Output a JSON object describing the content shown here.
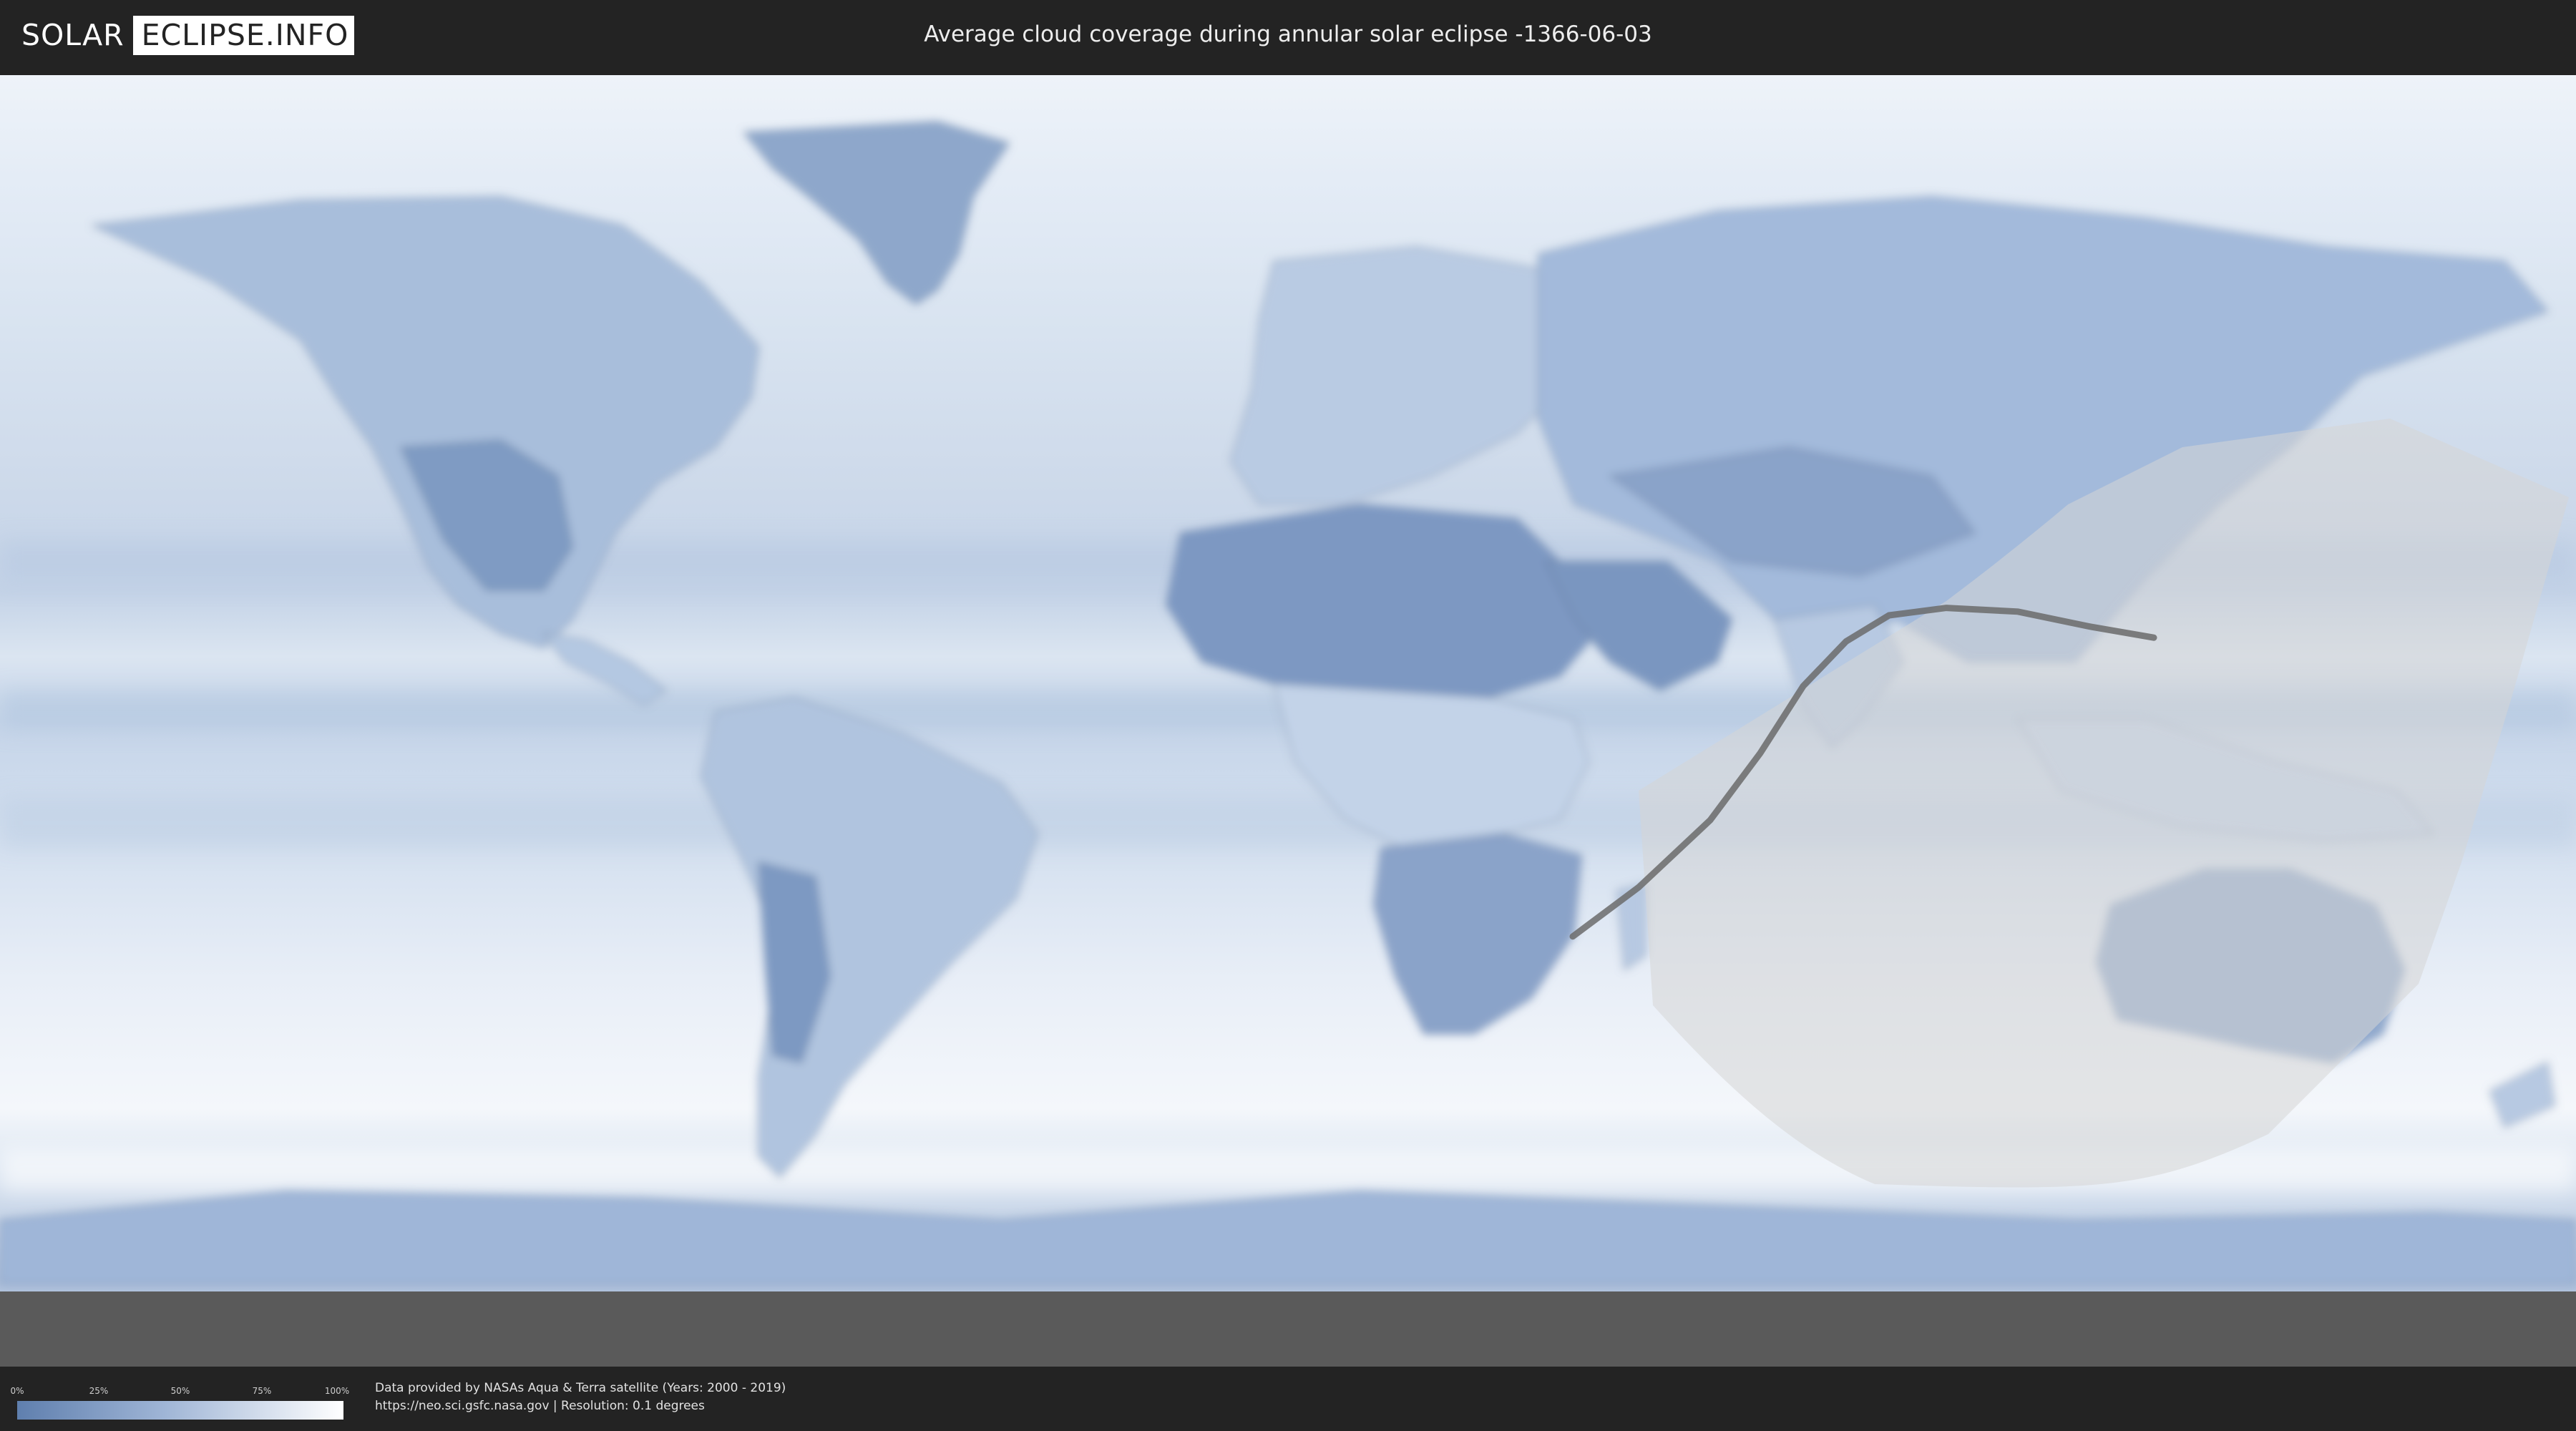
{
  "header": {
    "logo": {
      "part1": "SOLAR",
      "part2": "ECLIPSE.INFO"
    },
    "title": "Average cloud coverage during annular solar eclipse -1366-06-03"
  },
  "map": {
    "layer": "cloud-coverage",
    "colors": {
      "clear": "#5f7fae",
      "cloudy": "#ffffff",
      "eclipse_zone": "#d6d6d6",
      "central_line": "#6b6b6b",
      "page_bg": "#232323"
    },
    "central_line_path": [
      [
        39.8,
        -31.6
      ],
      [
        49,
        -25
      ],
      [
        59,
        -16
      ],
      [
        66,
        -7
      ],
      [
        72,
        2
      ],
      [
        78,
        8
      ],
      [
        84,
        11.5
      ],
      [
        92,
        12.5
      ],
      [
        102,
        12
      ],
      [
        112,
        10
      ],
      [
        121,
        8.5
      ]
    ]
  },
  "legend": {
    "ticks": [
      "0%",
      "25%",
      "50%",
      "75%",
      "100%"
    ]
  },
  "attribution": {
    "line1": "Data provided by NASAs Aqua & Terra satellite (Years: 2000 - 2019)",
    "line2": "https://neo.sci.gsfc.nasa.gov | Resolution: 0.1 degrees"
  }
}
